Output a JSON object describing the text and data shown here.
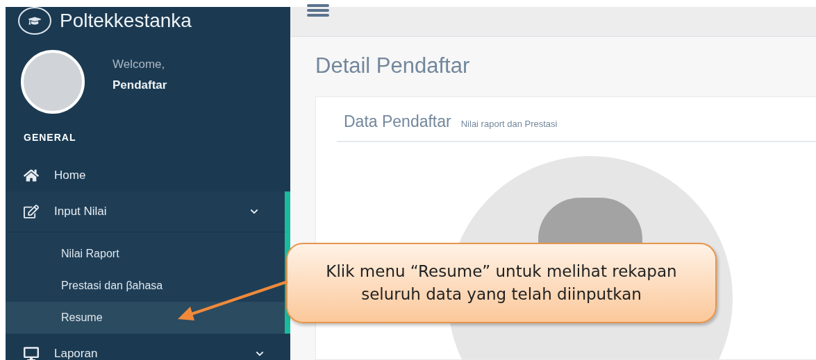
{
  "brand": {
    "title": "Poltekkestanka"
  },
  "profile": {
    "greeting": "Welcome,",
    "name": "Pendaftar"
  },
  "sidebar": {
    "section": "GENERAL",
    "items": [
      {
        "kind": "home",
        "label": "Home",
        "expanded": false,
        "collapsible": false
      },
      {
        "kind": "edit",
        "label": "Input Nilai",
        "expanded": true,
        "collapsible": true,
        "children": [
          {
            "label": "Nilai Raport",
            "selected": false
          },
          {
            "label": "Prestasi dan βahasa",
            "selected": false
          },
          {
            "label": "Resume",
            "selected": true
          }
        ]
      },
      {
        "kind": "monitor",
        "label": "Laporan",
        "expanded": false,
        "collapsible": true
      }
    ]
  },
  "page": {
    "title": "Detail Pendaftar",
    "card_title": "Data Pendaftar",
    "card_subtitle": "Nilai raport dan Prestasi"
  },
  "callout": {
    "text": "Klik menu “Resume” untuk melihat rekapan seluruh data yang telah diinputkan"
  }
}
